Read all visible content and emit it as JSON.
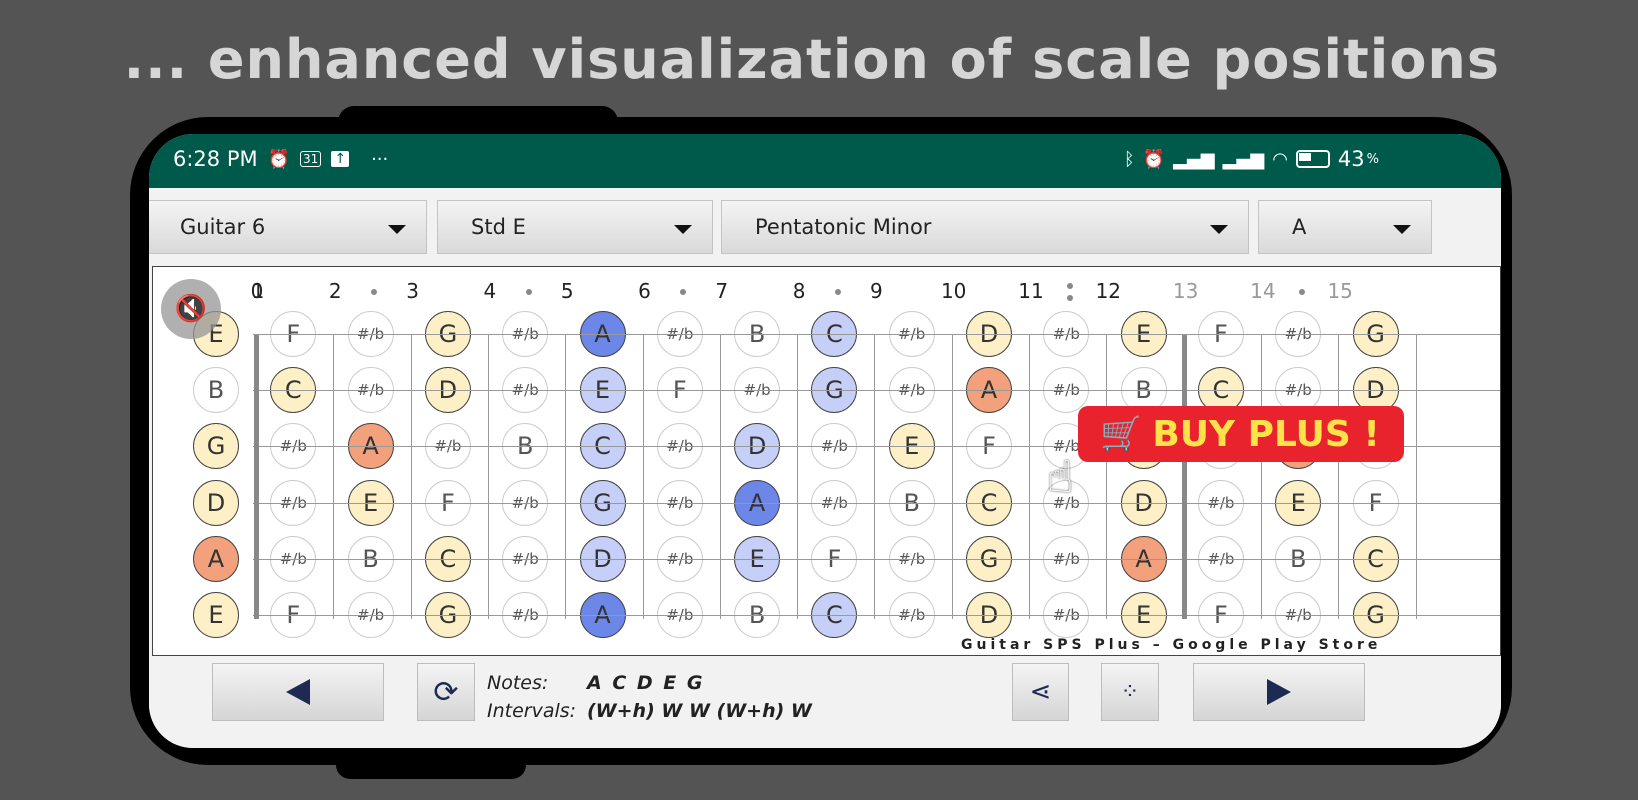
{
  "headline": "... enhanced visualization of scale positions",
  "status_bar": {
    "time": "6:28 PM",
    "left_icons": [
      "alarm-icon",
      "calendar-icon",
      "upload-icon",
      "more-icon"
    ],
    "calendar_day": "31",
    "more": "···",
    "right_icons": [
      "bluetooth-icon",
      "alarm-icon",
      "signal-icon",
      "signal-icon",
      "wifi-icon",
      "battery-icon"
    ],
    "battery": "43",
    "battery_unit": "%"
  },
  "toolbar": {
    "instrument": "Guitar 6",
    "tuning": "Std E",
    "scale": "Pentatonic Minor",
    "key": "A"
  },
  "fretboard": {
    "fret_numbers": [
      "0",
      "1",
      "2",
      "3",
      "4",
      "5",
      "6",
      "7",
      "8",
      "9",
      "10",
      "11",
      "12",
      "13",
      "14",
      "15"
    ],
    "accidental_label": "#/b",
    "strings": [
      [
        "E:y",
        "F",
        "#",
        "G:y",
        "#",
        "A:b",
        "#",
        "B",
        "C:l",
        "#",
        "D:y",
        "#",
        "E:y",
        "F",
        "#",
        "G:y"
      ],
      [
        "B",
        "C:y",
        "#",
        "D:y",
        "#",
        "E:l",
        "F",
        "#",
        "G:l",
        "#",
        "A:r",
        "#",
        "B",
        "C:y",
        "#",
        "D:y"
      ],
      [
        "G:y",
        "#",
        "A:r",
        "#",
        "B",
        "C:l",
        "#",
        "D:l",
        "#",
        "E:y",
        "F",
        "#",
        "G:y",
        "#",
        "A:r",
        "#"
      ],
      [
        "D:y",
        "#",
        "E:y",
        "F",
        "#",
        "G:l",
        "#",
        "A:b",
        "#",
        "B",
        "C:y",
        "#",
        "D:y",
        "#",
        "E:y",
        "F"
      ],
      [
        "A:r",
        "#",
        "B",
        "C:y",
        "#",
        "D:l",
        "#",
        "E:l",
        "F",
        "#",
        "G:y",
        "#",
        "A:r",
        "#",
        "B",
        "C:y"
      ],
      [
        "E:y",
        "F",
        "#",
        "G:y",
        "#",
        "A:b",
        "#",
        "B",
        "C:l",
        "#",
        "D:y",
        "#",
        "E:y",
        "F",
        "#",
        "G:y"
      ]
    ]
  },
  "watermark": "Guitar SPS Plus  –  Google Play Store",
  "buy_button": "BUY PLUS !",
  "info": {
    "notes_label": "Notes:",
    "notes_value": "A C D E G",
    "intervals_label": "Intervals:",
    "intervals_value": "(W+h) W W (W+h) W"
  },
  "colors": {
    "status_bar": "#005a4c",
    "in_scale": "#fdf0c6",
    "root": "#f2a17c",
    "position": "#c5cff7",
    "position_root": "#6c87e8",
    "buy": "#e8232e"
  }
}
